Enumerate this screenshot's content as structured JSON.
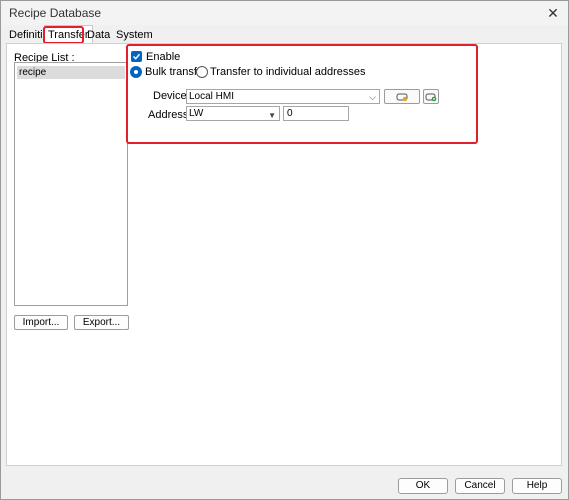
{
  "window": {
    "title": "Recipe Database",
    "close_icon": "close-icon"
  },
  "tabs": [
    {
      "label": "Definition"
    },
    {
      "label": "Transfer",
      "active": true
    },
    {
      "label": "Data"
    },
    {
      "label": "System Registers"
    }
  ],
  "recipe_panel": {
    "label": "Recipe List :",
    "items": [
      "recipe"
    ],
    "import_label": "Import...",
    "export_label": "Export..."
  },
  "transfer": {
    "enable_label": "Enable",
    "enable_checked": true,
    "bulk_label": "Bulk transfer",
    "individual_label": "Transfer to individual addresses",
    "selected_mode": "Bulk transfer",
    "device_label": "Device :",
    "device_value": "Local HMI",
    "address_label": "Address :",
    "address_type": "LW",
    "address_value": "0",
    "device_icons": [
      "device-settings-icon",
      "add-device-icon"
    ]
  },
  "footer": {
    "ok_label": "OK",
    "cancel_label": "Cancel",
    "help_label": "Help"
  },
  "colors": {
    "accent": "#0067c0",
    "highlight": "#e0202a"
  }
}
